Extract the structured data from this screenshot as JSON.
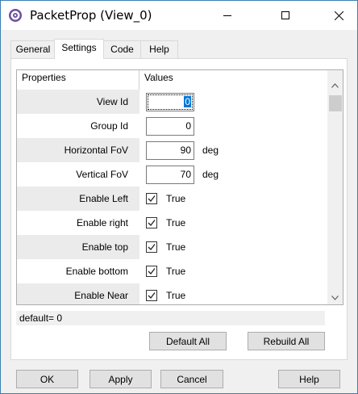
{
  "window": {
    "title": "PacketProp (View_0)",
    "icon": "app-icon",
    "controls": [
      "minimize-icon",
      "maximize-icon",
      "close-icon"
    ]
  },
  "tabs": [
    {
      "label": "General"
    },
    {
      "label": "Settings",
      "selected": true
    },
    {
      "label": "Code"
    },
    {
      "label": "Help"
    }
  ],
  "grid": {
    "columns": [
      "Properties",
      "Values"
    ],
    "rows": [
      {
        "label": "View Id",
        "type": "number",
        "value": "0",
        "unit": "",
        "focused": true
      },
      {
        "label": "Group Id",
        "type": "number",
        "value": "0",
        "unit": ""
      },
      {
        "label": "Horizontal FoV",
        "type": "number",
        "value": "90",
        "unit": "deg"
      },
      {
        "label": "Vertical FoV",
        "type": "number",
        "value": "70",
        "unit": "deg"
      },
      {
        "label": "Enable Left",
        "type": "checkbox",
        "checked": true,
        "value": "True"
      },
      {
        "label": "Enable right",
        "type": "checkbox",
        "checked": true,
        "value": "True"
      },
      {
        "label": "Enable top",
        "type": "checkbox",
        "checked": true,
        "value": "True"
      },
      {
        "label": "Enable bottom",
        "type": "checkbox",
        "checked": true,
        "value": "True"
      },
      {
        "label": "Enable Near",
        "type": "checkbox",
        "checked": true,
        "value": "True"
      }
    ]
  },
  "status": {
    "text": "default= 0"
  },
  "actions": {
    "default_all": "Default All",
    "rebuild_all": "Rebuild All"
  },
  "footer": {
    "ok": "OK",
    "apply": "Apply",
    "cancel": "Cancel",
    "help": "Help"
  },
  "colors": {
    "selection": "#0078d7",
    "shaded_row": "#ebebeb",
    "button_face": "#e1e1e1",
    "window_border": "#3c7fb1"
  }
}
